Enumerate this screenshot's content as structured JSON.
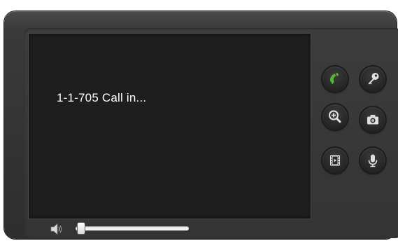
{
  "video": {
    "call_status": "1-1-705 Call in..."
  },
  "controls": {
    "answer": {
      "icon": "phone-handset-icon",
      "color": "#58b43a"
    },
    "unlock": {
      "icon": "key-icon"
    },
    "zoom": {
      "icon": "zoom-in-icon"
    },
    "snapshot": {
      "icon": "camera-icon"
    },
    "record": {
      "icon": "film-icon"
    },
    "microphone": {
      "icon": "microphone-icon"
    }
  },
  "volume": {
    "icon": "speaker-icon",
    "level": 0.03
  },
  "colors": {
    "screen": "#1e1e1e",
    "frame": "#333333",
    "icon": "#e0e0e0",
    "accent_green": "#58b43a"
  }
}
